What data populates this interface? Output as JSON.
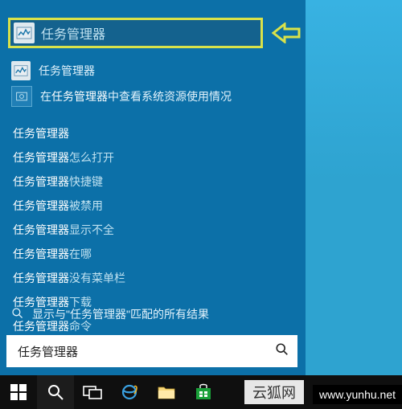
{
  "top_result": {
    "label": "任务管理器"
  },
  "result_app2": {
    "label": "任务管理器"
  },
  "result_setting": {
    "prefix": "在",
    "hl": "任务管理器",
    "suffix": "中查看系统资源使用情况"
  },
  "suggestions": [
    {
      "base": "任务管理器",
      "extra": ""
    },
    {
      "base": "任务管理器",
      "extra": "怎么打开"
    },
    {
      "base": "任务管理器",
      "extra": "快捷键"
    },
    {
      "base": "任务管理器",
      "extra": "被禁用"
    },
    {
      "base": "任务管理器",
      "extra": "显示不全"
    },
    {
      "base": "任务管理器",
      "extra": "在哪"
    },
    {
      "base": "任务管理器",
      "extra": "没有菜单栏"
    },
    {
      "base": "任务管理器",
      "extra": "下载"
    },
    {
      "base": "任务管理器",
      "extra": "命令"
    }
  ],
  "web_results": {
    "prefix": "显示与\"",
    "hl": "任务管理器",
    "suffix": "\"匹配的所有结果"
  },
  "searchbox": {
    "text": "任务管理器"
  },
  "watermark1": "云狐网",
  "watermark2": "www.yunhu.net"
}
